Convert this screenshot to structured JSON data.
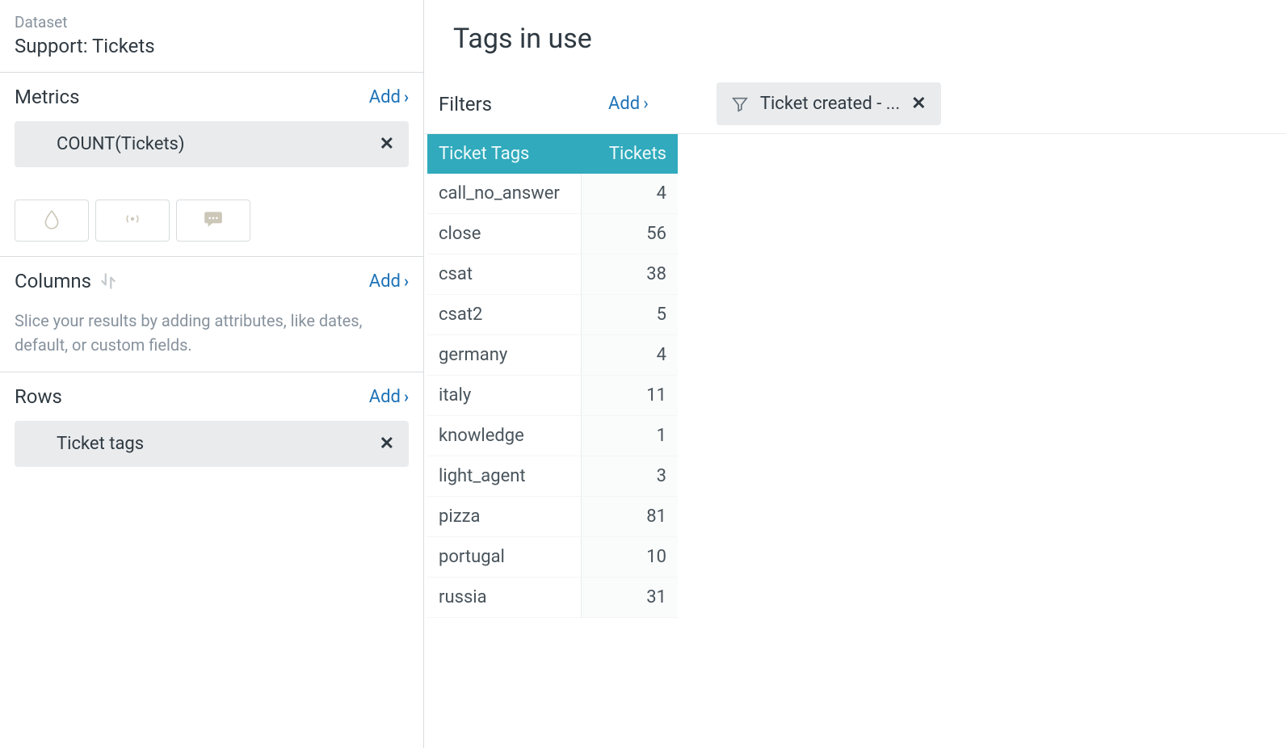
{
  "sidebar": {
    "dataset": {
      "label": "Dataset",
      "value": "Support: Tickets"
    },
    "metrics": {
      "title": "Metrics",
      "add_label": "Add",
      "chip": {
        "label": "COUNT(Tickets)"
      }
    },
    "columns": {
      "title": "Columns",
      "add_label": "Add",
      "hint": "Slice your results by adding attributes, like dates, default, or custom fields."
    },
    "rows": {
      "title": "Rows",
      "add_label": "Add",
      "chip": {
        "label": "Ticket tags"
      }
    }
  },
  "main": {
    "title": "Tags in use",
    "filters": {
      "label": "Filters",
      "add_label": "Add",
      "chip": {
        "label": "Ticket created - ..."
      }
    },
    "table": {
      "headers": {
        "tags": "Ticket Tags",
        "tickets": "Tickets"
      },
      "rows": [
        {
          "tag": "call_no_answer",
          "tickets": 4
        },
        {
          "tag": "close",
          "tickets": 56
        },
        {
          "tag": "csat",
          "tickets": 38
        },
        {
          "tag": "csat2",
          "tickets": 5
        },
        {
          "tag": "germany",
          "tickets": 4
        },
        {
          "tag": "italy",
          "tickets": 11
        },
        {
          "tag": "knowledge",
          "tickets": 1
        },
        {
          "tag": "light_agent",
          "tickets": 3
        },
        {
          "tag": "pizza",
          "tickets": 81
        },
        {
          "tag": "portugal",
          "tickets": 10
        },
        {
          "tag": "russia",
          "tickets": 31
        }
      ]
    }
  },
  "chart_data": {
    "type": "table",
    "title": "Tags in use",
    "columns": [
      "Ticket Tags",
      "Tickets"
    ],
    "rows": [
      [
        "call_no_answer",
        4
      ],
      [
        "close",
        56
      ],
      [
        "csat",
        38
      ],
      [
        "csat2",
        5
      ],
      [
        "germany",
        4
      ],
      [
        "italy",
        11
      ],
      [
        "knowledge",
        1
      ],
      [
        "light_agent",
        3
      ],
      [
        "pizza",
        81
      ],
      [
        "portugal",
        10
      ],
      [
        "russia",
        31
      ]
    ]
  }
}
